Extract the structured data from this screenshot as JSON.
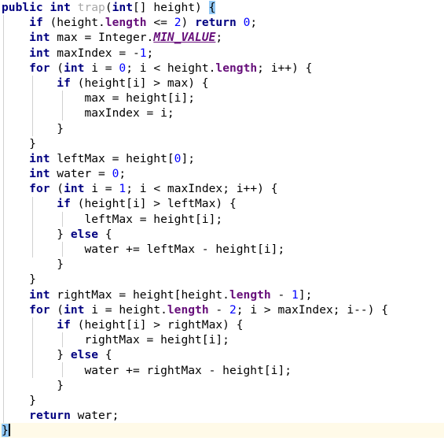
{
  "editor": {
    "language": "java",
    "theme": "light",
    "background_color": "#ffffff",
    "current_line_color": "#fffae8",
    "brace_match_color": "#93c9f5",
    "indent_guide_color": "#d0d0d0",
    "keyword_color": "#000080",
    "number_color": "#0000ff",
    "field_color": "#660e7a",
    "unused_symbol_color": "#a8a8a8",
    "method_name": "trap",
    "caret_line": 29
  },
  "code": {
    "line01": {
      "kw1": "public",
      "kw2": "int",
      "name": "trap",
      "p1": "(",
      "kw3": "int",
      "p2": "[] height) ",
      "brace": "{"
    },
    "line02": {
      "ind": "    ",
      "kw1": "if",
      "p1": " (height.",
      "fld": "length",
      "p2": " <= ",
      "num": "2",
      "p3": ") ",
      "kw2": "return",
      "p4": " ",
      "num2": "0",
      "p5": ";"
    },
    "line03": {
      "ind": "    ",
      "kw1": "int",
      "p1": " max = Integer.",
      "sfld": "MIN_VALUE",
      "p2": ";"
    },
    "line04": {
      "ind": "    ",
      "kw1": "int",
      "p1": " maxIndex = -",
      "num": "1",
      "p2": ";"
    },
    "line05": {
      "ind": "    ",
      "kw1": "for",
      "p1": " (",
      "kw2": "int",
      "p2": " i = ",
      "num": "0",
      "p3": "; i < height.",
      "fld": "length",
      "p4": "; i++) {"
    },
    "line06": {
      "ind": "        ",
      "kw1": "if",
      "p1": " (height[i] > max) {"
    },
    "line07": {
      "ind": "            ",
      "p1": "max = height[i];"
    },
    "line08": {
      "ind": "            ",
      "p1": "maxIndex = i;"
    },
    "line09": {
      "ind": "        ",
      "p1": "}"
    },
    "line10": {
      "ind": "    ",
      "p1": "}"
    },
    "line11": {
      "ind": "    ",
      "kw1": "int",
      "p1": " leftMax = height[",
      "num": "0",
      "p2": "];"
    },
    "line12": {
      "ind": "    ",
      "kw1": "int",
      "p1": " water = ",
      "num": "0",
      "p2": ";"
    },
    "line13": {
      "ind": "    ",
      "kw1": "for",
      "p1": " (",
      "kw2": "int",
      "p2": " i = ",
      "num": "1",
      "p3": "; i < maxIndex; i++) {"
    },
    "line14": {
      "ind": "        ",
      "kw1": "if",
      "p1": " (height[i] > leftMax) {"
    },
    "line15": {
      "ind": "            ",
      "p1": "leftMax = height[i];"
    },
    "line16": {
      "ind": "        ",
      "p1": "} ",
      "kw1": "else",
      "p2": " {"
    },
    "line17": {
      "ind": "            ",
      "p1": "water += leftMax - height[i];"
    },
    "line18": {
      "ind": "        ",
      "p1": "}"
    },
    "line19": {
      "ind": "    ",
      "p1": "}"
    },
    "line20": {
      "ind": "    ",
      "kw1": "int",
      "p1": " rightMax = height[height.",
      "fld": "length",
      "p2": " - ",
      "num": "1",
      "p3": "];"
    },
    "line21": {
      "ind": "    ",
      "kw1": "for",
      "p1": " (",
      "kw2": "int",
      "p2": " i = height.",
      "fld": "length",
      "p3": " - ",
      "num": "2",
      "p4": "; i > maxIndex; i--) {"
    },
    "line22": {
      "ind": "        ",
      "kw1": "if",
      "p1": " (height[i] > rightMax) {"
    },
    "line23": {
      "ind": "            ",
      "p1": "rightMax = height[i];"
    },
    "line24": {
      "ind": "        ",
      "p1": "} ",
      "kw1": "else",
      "p2": " {"
    },
    "line25": {
      "ind": "            ",
      "p1": "water += rightMax - height[i];"
    },
    "line26": {
      "ind": "        ",
      "p1": "}"
    },
    "line27": {
      "ind": "    ",
      "p1": "}"
    },
    "line28": {
      "ind": "    ",
      "kw1": "return",
      "p1": " water;"
    },
    "line29": {
      "brace": "}"
    }
  }
}
